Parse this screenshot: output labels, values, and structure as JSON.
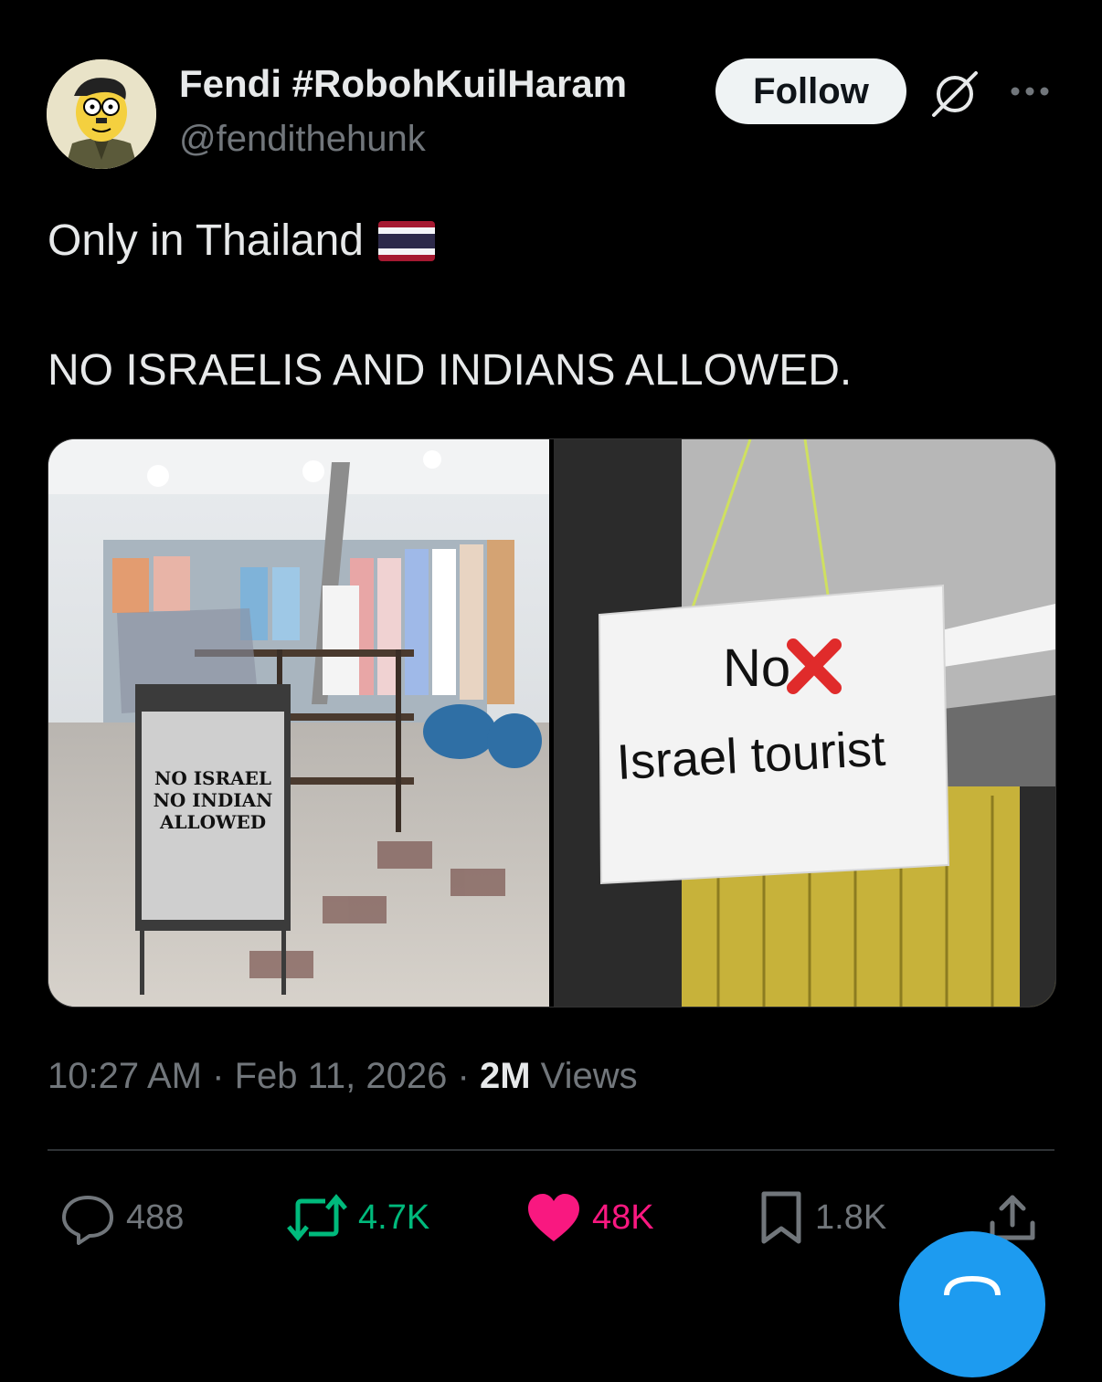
{
  "author": {
    "display_name": "Fendi #RobohKuilHaram",
    "handle": "@fendithehunk"
  },
  "header": {
    "follow_label": "Follow"
  },
  "post": {
    "line1": "Only in Thailand",
    "line2": "NO ISRAELIS AND INDIANS ALLOWED.",
    "left_image": {
      "sign_lines": [
        "NO ISRAEL",
        "NO INDIAN",
        "ALLOWED"
      ]
    },
    "right_image": {
      "sign_line1": "No",
      "sign_line2": "Israel tourist"
    }
  },
  "meta": {
    "time": "10:27 AM",
    "separator": "·",
    "date": "Feb 11, 2026",
    "views_count": "2M",
    "views_label": "Views"
  },
  "actions": {
    "replies": "488",
    "reposts": "4.7K",
    "likes": "48K",
    "bookmarks": "1.8K"
  },
  "colors": {
    "background": "#000000",
    "text_primary": "#e7e9ea",
    "text_secondary": "#71767b",
    "repost_green": "#00ba7c",
    "like_pink": "#f91880",
    "accent_blue": "#1d9bf0"
  },
  "icons": [
    "grok-icon",
    "more-icon",
    "reply-icon",
    "repost-icon",
    "like-icon",
    "bookmark-icon",
    "share-icon",
    "thailand-flag-icon"
  ]
}
